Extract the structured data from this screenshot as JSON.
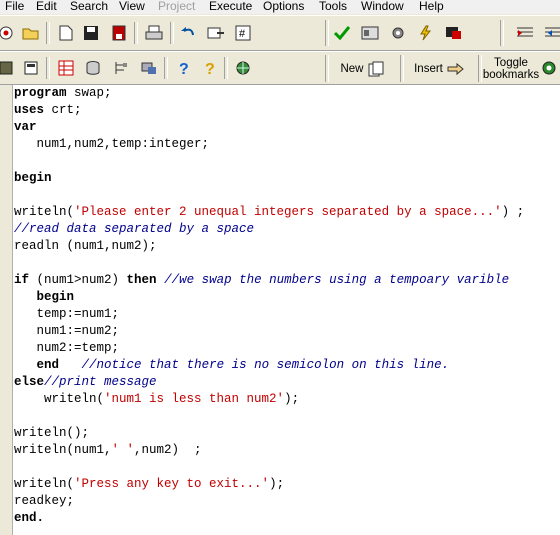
{
  "menu": [
    "File",
    "Edit",
    "Search",
    "View",
    "Project",
    "Execute",
    "Options",
    "Tools",
    "Window",
    "Help"
  ],
  "toolbar": {
    "new_label": "New",
    "insert_label": "Insert",
    "toggle_line1": "Toggle",
    "toggle_line2": "bookmarks"
  },
  "code": [
    [
      "program",
      "swap;"
    ],
    [
      "uses",
      "crt;"
    ],
    [
      "var"
    ],
    [
      "num1,num2,temp:integer;"
    ],
    [],
    [
      "begin"
    ],
    [],
    [
      "writeln(",
      "'Please enter 2 unequal integers separated by a space...'",
      ") ;"
    ],
    [
      "//read data separated by a space"
    ],
    [
      "readln (num1,num2);"
    ],
    [],
    [
      "if",
      " (num1>num2) ",
      "then",
      " ",
      "//we swap the numbers using a tempoary varible"
    ],
    [
      "begin"
    ],
    [
      "temp:=num1;"
    ],
    [
      "num1:=num2;"
    ],
    [
      "num2:=temp;"
    ],
    [
      "end",
      "   ",
      "//notice that there is no semicolon on this line."
    ],
    [
      "else",
      "//print message"
    ],
    [
      "writeln(",
      "'num1 is less than num2'",
      ");"
    ],
    [],
    [
      "writeln();"
    ],
    [
      "writeln(num1,",
      "' '",
      ",num2)  ;"
    ],
    [],
    [
      "writeln(",
      "'Press any key to exit...'",
      ");"
    ],
    [
      "readkey;"
    ],
    [
      "end."
    ]
  ]
}
